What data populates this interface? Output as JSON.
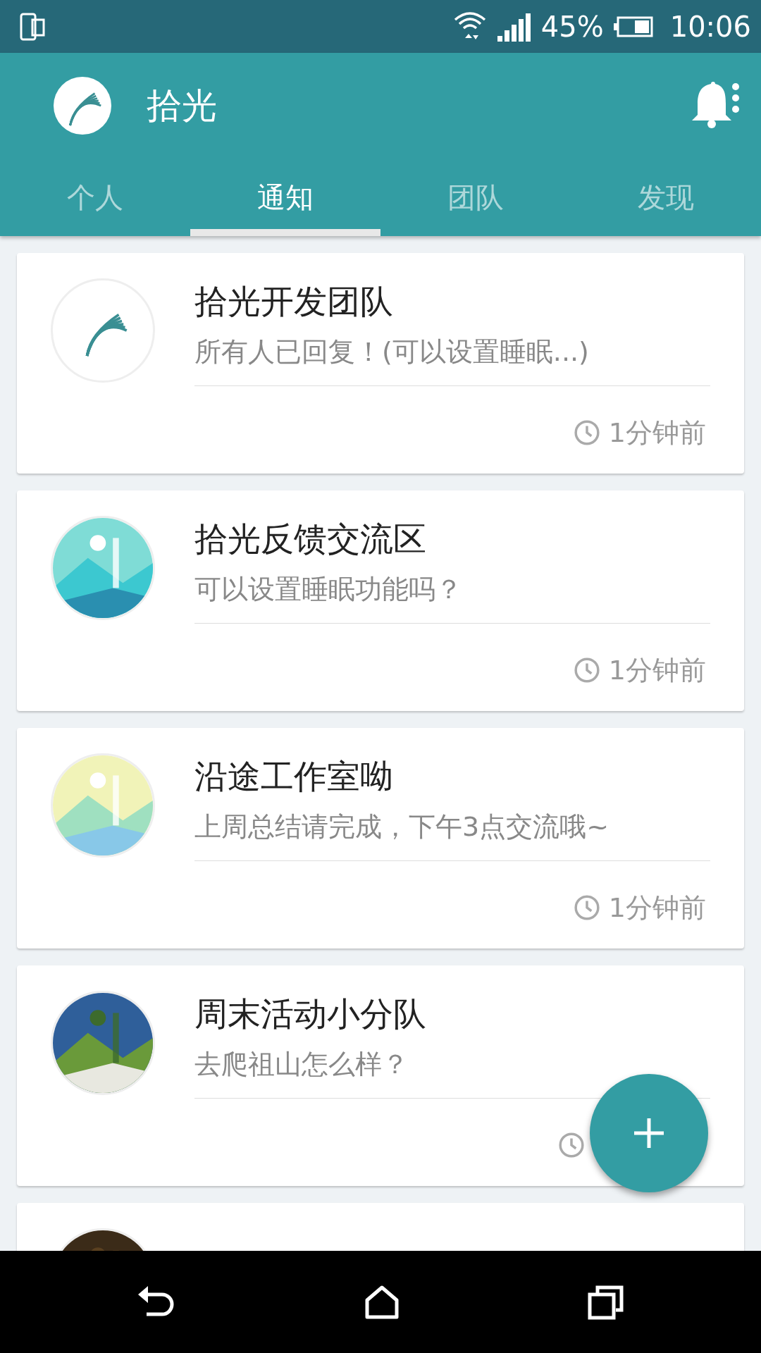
{
  "status_bar": {
    "battery": "45%",
    "time": "10:06"
  },
  "app_bar": {
    "title": "拾光"
  },
  "tabs": [
    {
      "label": "个人",
      "selected": false
    },
    {
      "label": "通知",
      "selected": true
    },
    {
      "label": "团队",
      "selected": false
    },
    {
      "label": "发现",
      "selected": false
    }
  ],
  "cards": [
    {
      "avatar": {
        "kind": "logo"
      },
      "title": "拾光开发团队",
      "message": "所有人已回复！(可以设置睡眠...)",
      "time": "1分钟前"
    },
    {
      "avatar": {
        "kind": "picture"
      },
      "title": "拾光反馈交流区",
      "message": "可以设置睡眠功能吗？",
      "time": "1分钟前"
    },
    {
      "avatar": {
        "kind": "picture"
      },
      "title": "沿途工作室呦",
      "message": "上周总结请完成，下午3点交流哦~",
      "time": "1分钟前"
    },
    {
      "avatar": {
        "kind": "picture"
      },
      "title": "周末活动小分队",
      "message": "去爬祖山怎么样？"
    },
    {
      "avatar": {
        "kind": "picture"
      }
    }
  ]
}
